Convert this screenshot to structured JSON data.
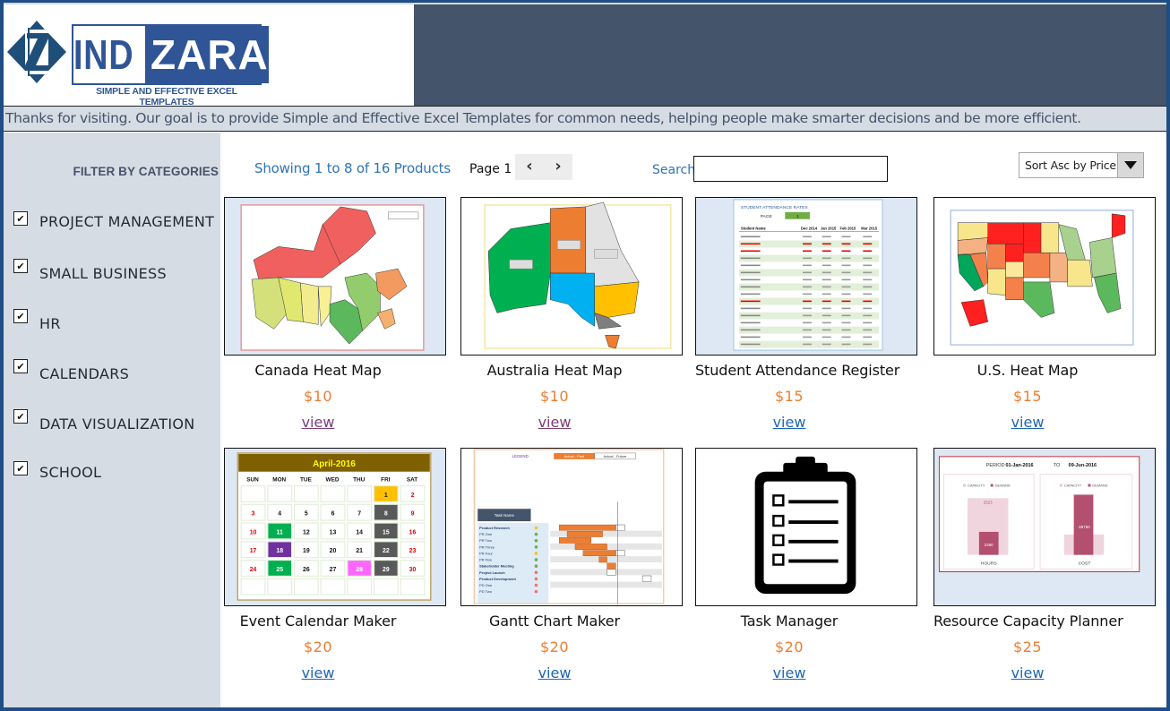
{
  "brand": {
    "logo_left": "IND",
    "logo_right": "ZARA",
    "tagline": "SIMPLE AND EFFECTIVE EXCEL TEMPLATES",
    "emblem_letter": "Z"
  },
  "banner": {
    "text": "Thanks for visiting. Our goal is to provide Simple and Effective Excel Templates for common needs, helping people make smarter decisions and be more efficient."
  },
  "sidebar": {
    "title": "FILTER BY CATEGORIES",
    "categories": [
      {
        "label": "PROJECT MANAGEMENT",
        "checked": true
      },
      {
        "label": "SMALL BUSINESS",
        "checked": true
      },
      {
        "label": "HR",
        "checked": true
      },
      {
        "label": "CALENDARS",
        "checked": true
      },
      {
        "label": "DATA VISUALIZATION",
        "checked": true
      },
      {
        "label": "SCHOOL",
        "checked": true
      }
    ],
    "check_glyph": "✔"
  },
  "toolbar": {
    "showing": "Showing 1 to 8 of 16 Products",
    "page_label": "Page 1",
    "prev_icon": "‹",
    "next_icon": "›",
    "search_label": "Search",
    "search_value": "",
    "sort_value": "Sort Asc by Price"
  },
  "products": [
    {
      "name": "Canada Heat Map",
      "price": "$10",
      "link": "view",
      "thumbnail": "canada-map"
    },
    {
      "name": "Australia Heat Map",
      "price": "$10",
      "link": "view",
      "thumbnail": "australia-map"
    },
    {
      "name": "Student Attendance Register",
      "price": "$15",
      "link": "view",
      "thumbnail": "attendance-table"
    },
    {
      "name": "U.S. Heat Map",
      "price": "$15",
      "link": "view",
      "thumbnail": "us-map"
    },
    {
      "name": "Event Calendar Maker",
      "price": "$20",
      "link": "view",
      "thumbnail": "calendar"
    },
    {
      "name": "Gantt Chart Maker",
      "price": "$20",
      "link": "view",
      "thumbnail": "gantt-chart"
    },
    {
      "name": "Task Manager",
      "price": "$20",
      "link": "view",
      "thumbnail": "clipboard-checklist"
    },
    {
      "name": "Resource Capacity Planner",
      "price": "$25",
      "link": "view",
      "thumbnail": "capacity-chart"
    }
  ],
  "thumbs": {
    "calendar": {
      "title": "April-2016",
      "weekdays": [
        "SUN",
        "MON",
        "TUE",
        "WED",
        "THU",
        "FRI",
        "SAT"
      ]
    },
    "attendance": {
      "title": "STUDENT ATTENDANCE RATES",
      "page_label": "PAGE",
      "page_value": "1",
      "headers": [
        "Student Name",
        "Dec 2014",
        "Jan 2015",
        "Feb 2015",
        "Mar 2015"
      ]
    },
    "capacity": {
      "period_label": "PERIOD",
      "from": "01-Jan-2016",
      "to_label": "TO",
      "to": "09-Jun-2016",
      "legend": [
        "CAPACITY",
        "DEMAND"
      ],
      "hours_label": "HOURS",
      "cost_label": "COST",
      "hours_capacity": "2523",
      "hours_demand": "2360",
      "cost_demand": "86750"
    },
    "gantt": {
      "legend": "LEGEND",
      "past": "Actual - Past",
      "future": "Actual - Future",
      "task_header": "Task Name",
      "tasks": [
        "Product Research",
        "PR One",
        "PR Two",
        "PR Three",
        "PR Four",
        "PR Five",
        "Stakeholder Meeting",
        "Project Launch",
        "Product Development",
        "PD One",
        "PD Two"
      ]
    }
  },
  "colors": {
    "brand_blue": "#2f5597",
    "header_dark": "#44546a",
    "banner_bg": "#d6dce4",
    "link_blue": "#2e75b6",
    "price_orange": "#ed7d31",
    "visited_link": "#7a3e78"
  }
}
